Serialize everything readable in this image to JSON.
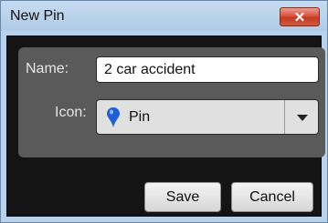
{
  "dialog": {
    "title": "New Pin",
    "close_label": "✕"
  },
  "form": {
    "name_label": "Name:",
    "name_value": "2 car accident",
    "icon_label": "Icon:",
    "icon_value": "Pin",
    "icon_symbol": "pin-icon",
    "pin_color": "#1f5fd1"
  },
  "buttons": {
    "save_label": "Save",
    "cancel_label": "Cancel"
  }
}
